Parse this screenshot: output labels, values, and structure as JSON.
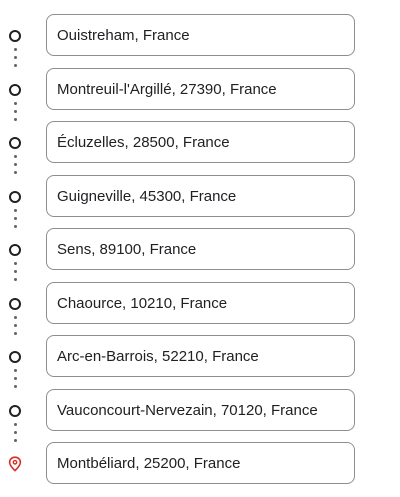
{
  "route": {
    "stops": [
      {
        "label": "Ouistreham, France",
        "type": "waypoint",
        "icon": "circle-icon"
      },
      {
        "label": "Montreuil-l'Argillé, 27390, France",
        "type": "waypoint",
        "icon": "circle-icon"
      },
      {
        "label": "Écluzelles, 28500, France",
        "type": "waypoint",
        "icon": "circle-icon"
      },
      {
        "label": "Guigneville, 45300, France",
        "type": "waypoint",
        "icon": "circle-icon"
      },
      {
        "label": "Sens, 89100, France",
        "type": "waypoint",
        "icon": "circle-icon"
      },
      {
        "label": "Chaource, 10210, France",
        "type": "waypoint",
        "icon": "circle-icon"
      },
      {
        "label": "Arc-en-Barrois, 52210, France",
        "type": "waypoint",
        "icon": "circle-icon"
      },
      {
        "label": "Vauconcourt-Nervezain, 70120, France",
        "type": "waypoint",
        "icon": "circle-icon"
      },
      {
        "label": "Montbéliard, 25200, France",
        "type": "destination",
        "icon": "location-pin-icon"
      }
    ]
  },
  "colors": {
    "waypoint_icon": "#202124",
    "destination_icon": "#d93025",
    "connector_dots": "#5f6368",
    "field_border": "#8e8e8e",
    "text": "#202124"
  }
}
